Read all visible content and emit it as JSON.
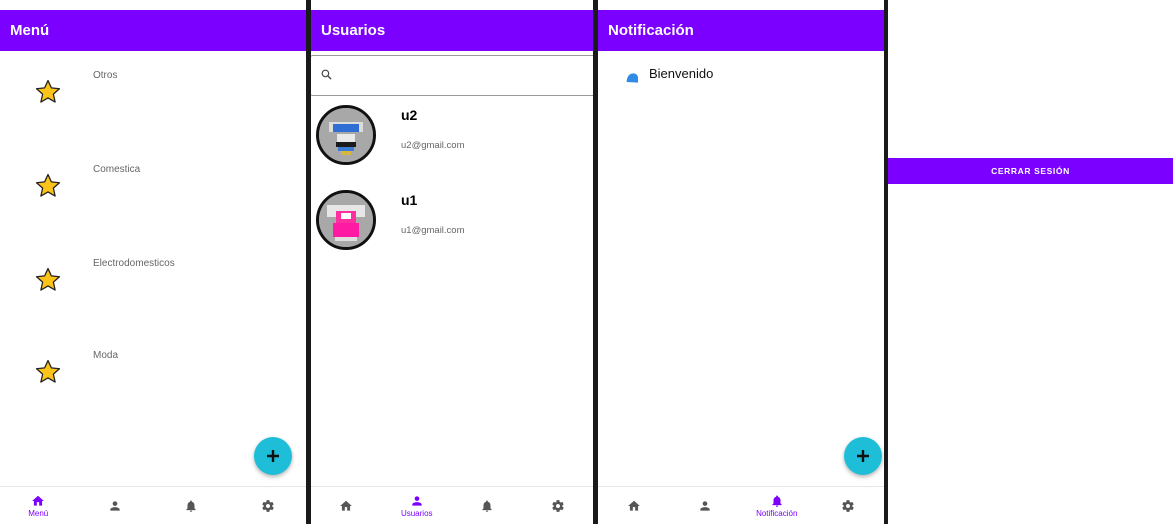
{
  "menu_screen": {
    "title": "Menú",
    "categories": [
      {
        "label": "Otros",
        "icon": "star-icon"
      },
      {
        "label": "Comestica",
        "icon": "star-icon"
      },
      {
        "label": "Electrodomesticos",
        "icon": "star-icon"
      },
      {
        "label": "Moda",
        "icon": "star-icon"
      }
    ],
    "fab_icon": "plus-icon"
  },
  "users_screen": {
    "title": "Usuarios",
    "search": {
      "placeholder": "",
      "value": "",
      "icon": "search-icon"
    },
    "users": [
      {
        "name": "u2",
        "email": "u2@gmail.com"
      },
      {
        "name": "u1",
        "email": "u1@gmail.com"
      }
    ]
  },
  "notifications_screen": {
    "title": "Notificación",
    "items": [
      {
        "text": "Bienvenido",
        "icon": "notification-icon"
      }
    ],
    "fab_icon": "plus-icon"
  },
  "settings_screen": {
    "logout_label": "CERRAR SESIÓN"
  },
  "nav_labels": {
    "menu": "Menú",
    "users": "Usuarios",
    "notifications": "Notificación"
  },
  "colors": {
    "primary": "#7b00ff",
    "fab": "#1ebed8",
    "star": "#fcc419"
  }
}
